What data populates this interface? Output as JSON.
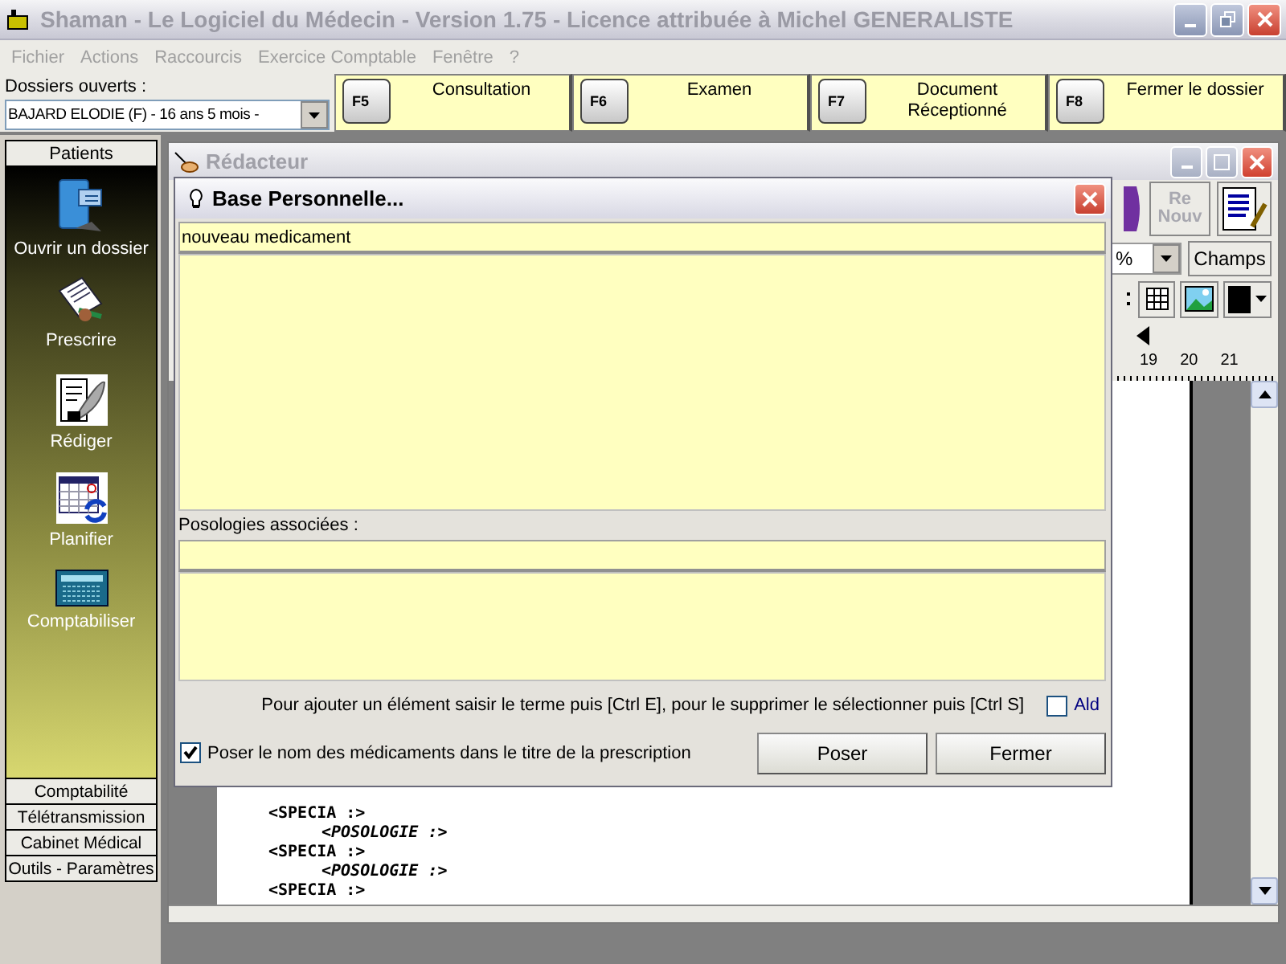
{
  "window": {
    "title": "Shaman - Le Logiciel du Médecin - Version 1.75 - Licence attribuée à Michel GENERALISTE"
  },
  "menu": [
    {
      "label": "Fichier",
      "disabled": true
    },
    {
      "label": "Actions",
      "disabled": true
    },
    {
      "label": "Raccourcis",
      "disabled": true
    },
    {
      "label": "Exercice Comptable",
      "disabled": true
    },
    {
      "label": "Fenêtre",
      "disabled": true
    },
    {
      "label": "?",
      "disabled": true
    }
  ],
  "open_files": {
    "label": "Dossiers ouverts :",
    "value": "BAJARD ELODIE (F) -  16 ans 5 mois -"
  },
  "function_keys": [
    {
      "key": "F5",
      "label": "Consultation"
    },
    {
      "key": "F6",
      "label": "Examen"
    },
    {
      "key": "F7",
      "label": "Document Réceptionné"
    },
    {
      "key": "F8",
      "label": "Fermer le dossier"
    }
  ],
  "sidebar": {
    "header": "Patients",
    "items": [
      {
        "label": "Ouvrir un dossier",
        "kind": "folder"
      },
      {
        "label": "Prescrire",
        "kind": "prescription"
      },
      {
        "label": "Rédiger",
        "kind": "write"
      },
      {
        "label": "Planifier",
        "kind": "calendar"
      },
      {
        "label": "Comptabiliser",
        "kind": "calculator"
      }
    ],
    "sections": [
      "Comptabilité",
      "Télétransmission",
      "Cabinet Médical",
      "Outils - Paramètres"
    ]
  },
  "editor": {
    "title": "Rédacteur",
    "renew_label": "Re Nouv",
    "zoom_value": "%",
    "fields_button": "Champs",
    "ruler": [
      "19",
      "20",
      "21"
    ],
    "lines": [
      {
        "kind": "specia",
        "text": "<SPECIA :>"
      },
      {
        "kind": "posologie",
        "text": "<POSOLOGIE :>"
      },
      {
        "kind": "specia",
        "text": "<SPECIA :>"
      },
      {
        "kind": "posologie",
        "text": "<POSOLOGIE :>"
      },
      {
        "kind": "specia",
        "text": "<SPECIA :>"
      }
    ]
  },
  "dialog": {
    "title": "Base Personnelle...",
    "search_value": "nouveau medicament",
    "dosages_label": "Posologies associées :",
    "hint": "Pour ajouter un élément saisir le terme puis [Ctrl E], pour le supprimer le sélectionner puis [Ctrl S]",
    "ald": {
      "label": "Ald",
      "checked": false
    },
    "put_names": {
      "label": "Poser le nom des médicaments dans le titre de la prescription",
      "checked": true
    },
    "buttons": [
      "Poser",
      "Fermer"
    ]
  }
}
